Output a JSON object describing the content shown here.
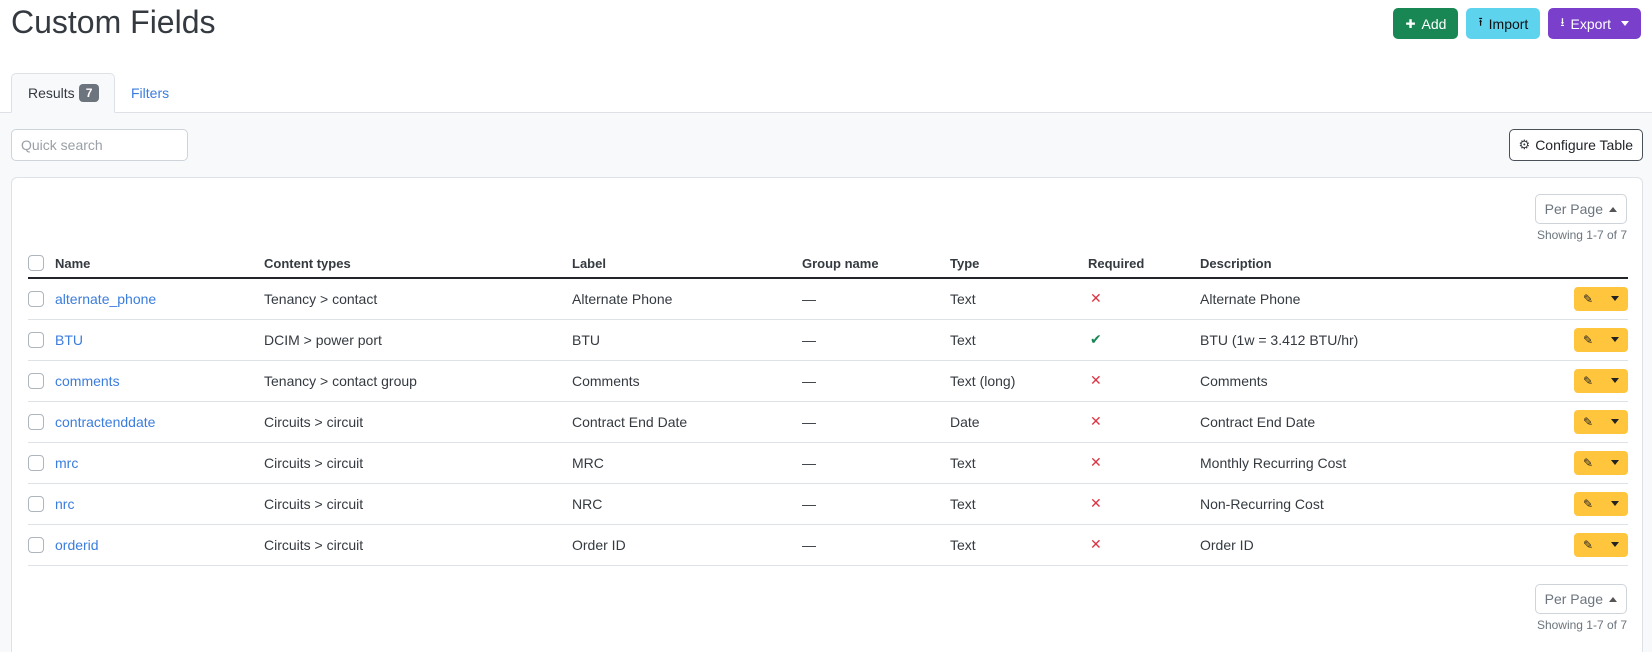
{
  "header": {
    "title": "Custom Fields",
    "add_label": "Add",
    "import_label": "Import",
    "export_label": "Export"
  },
  "tabs": {
    "results_label": "Results",
    "results_count": "7",
    "filters_label": "Filters"
  },
  "search": {
    "placeholder": "Quick search"
  },
  "configure_label": "Configure Table",
  "pagination": {
    "per_page_label": "Per Page",
    "showing_text": "Showing 1-7 of 7"
  },
  "table": {
    "columns": [
      "Name",
      "Content types",
      "Label",
      "Group name",
      "Type",
      "Required",
      "Description"
    ],
    "rows": [
      {
        "name": "alternate_phone",
        "content_types": "Tenancy > contact",
        "label": "Alternate Phone",
        "group": "—",
        "type": "Text",
        "required": false,
        "description": "Alternate Phone"
      },
      {
        "name": "BTU",
        "content_types": "DCIM > power port",
        "label": "BTU",
        "group": "—",
        "type": "Text",
        "required": true,
        "description": "BTU (1w = 3.412 BTU/hr)"
      },
      {
        "name": "comments",
        "content_types": "Tenancy > contact group",
        "label": "Comments",
        "group": "—",
        "type": "Text (long)",
        "required": false,
        "description": "Comments"
      },
      {
        "name": "contractenddate",
        "content_types": "Circuits > circuit",
        "label": "Contract End Date",
        "group": "—",
        "type": "Date",
        "required": false,
        "description": "Contract End Date"
      },
      {
        "name": "mrc",
        "content_types": "Circuits > circuit",
        "label": "MRC",
        "group": "—",
        "type": "Text",
        "required": false,
        "description": "Monthly Recurring Cost"
      },
      {
        "name": "nrc",
        "content_types": "Circuits > circuit",
        "label": "NRC",
        "group": "—",
        "type": "Text",
        "required": false,
        "description": "Non-Recurring Cost"
      },
      {
        "name": "orderid",
        "content_types": "Circuits > circuit",
        "label": "Order ID",
        "group": "—",
        "type": "Text",
        "required": false,
        "description": "Order ID"
      }
    ]
  },
  "icons": {
    "add": "plus-icon",
    "import": "upload-icon",
    "export": "download-icon",
    "configure": "gear-icon",
    "edit": "pencil-icon",
    "required_true": "check-icon",
    "required_false": "x-icon"
  },
  "colors": {
    "add": "#198754",
    "import": "#5ed3ee",
    "export": "#7a3fcb",
    "link": "#3b7ddd",
    "action": "#ffc53d",
    "required_true": "#198754",
    "required_false": "#dc3545"
  }
}
